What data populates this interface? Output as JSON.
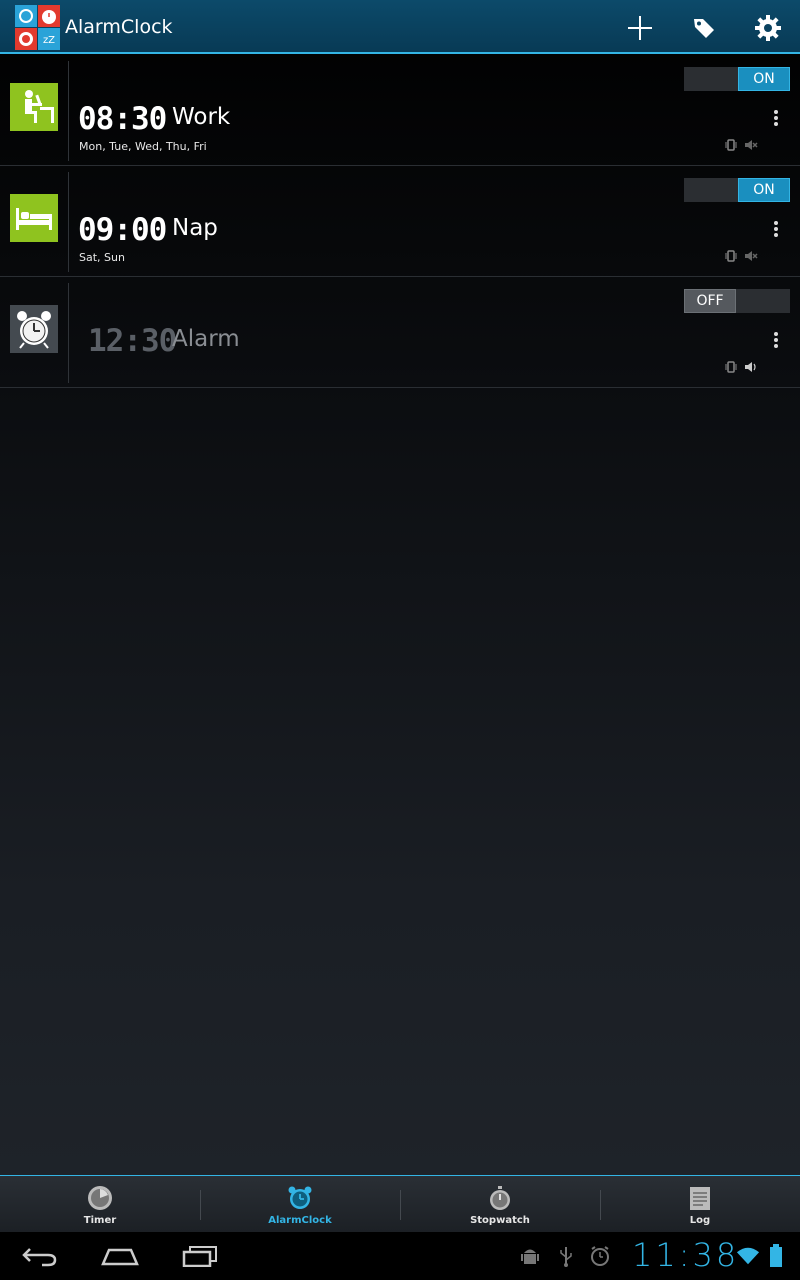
{
  "app": {
    "title": "AlarmClock"
  },
  "alarms": [
    {
      "time": "08:30",
      "name": "Work",
      "days": "Mon, Tue, Wed, Thu, Fri",
      "toggle": "ON",
      "icon": "desk-worker-icon"
    },
    {
      "time": "09:00",
      "name": "Nap",
      "days": "Sat, Sun",
      "toggle": "ON",
      "icon": "bed-icon"
    },
    {
      "time": "12:30",
      "name": "Alarm",
      "days": "",
      "toggle": "OFF",
      "icon": "alarm-clock-icon"
    }
  ],
  "tabs": [
    {
      "label": "Timer"
    },
    {
      "label": "AlarmClock"
    },
    {
      "label": "Stopwatch"
    },
    {
      "label": "Log"
    }
  ],
  "system": {
    "clock": "11:38"
  },
  "colors": {
    "accent": "#33b5e5",
    "icon_green": "#8fc31f",
    "actionbar": "#0a4260"
  }
}
